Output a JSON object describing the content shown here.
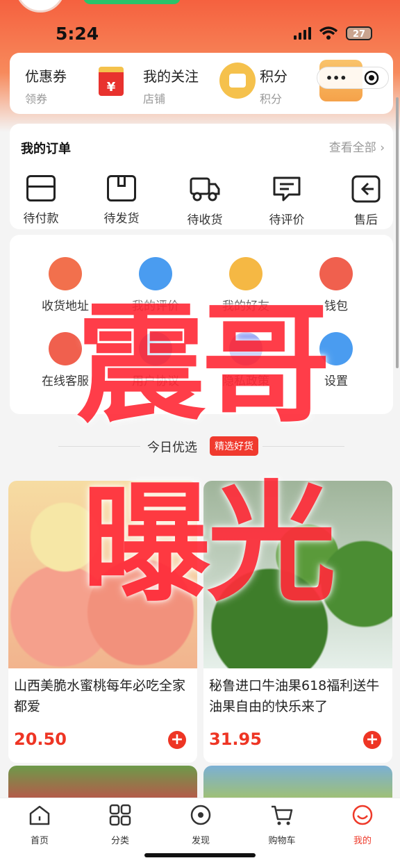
{
  "status_bar": {
    "time": "5:24",
    "battery": "27"
  },
  "top_card": {
    "coupon": {
      "title": "优惠券",
      "sub": "领券",
      "icon_text": "¥"
    },
    "follow": {
      "title": "我的关注",
      "sub": "店铺"
    },
    "points": {
      "title": "积分",
      "sub": "积分"
    },
    "mini_dots": "•••"
  },
  "orders": {
    "title": "我的订单",
    "view_all": "查看全部 ›",
    "items": [
      {
        "label": "待付款",
        "icon": "wallet-icon"
      },
      {
        "label": "待发货",
        "icon": "box-icon"
      },
      {
        "label": "待收货",
        "icon": "truck-icon"
      },
      {
        "label": "待评价",
        "icon": "comment-icon"
      },
      {
        "label": "售后",
        "icon": "return-icon"
      }
    ]
  },
  "services": [
    {
      "label": "收货地址",
      "icon": "location-icon",
      "color": "#f2704d"
    },
    {
      "label": "我的评价",
      "icon": "document-icon",
      "color": "#4a9cf0"
    },
    {
      "label": "我的好友",
      "icon": "crown-icon",
      "color": "#f5b844"
    },
    {
      "label": "钱包",
      "icon": "card-icon",
      "color": "#f0604e"
    },
    {
      "label": "在线客服",
      "icon": "headset-icon",
      "color": "#f0604e"
    },
    {
      "label": "用户协议",
      "icon": "agreement-icon",
      "color": "#4a9cf0"
    },
    {
      "label": "隐私政策",
      "icon": "privacy-icon",
      "color": "#7a8cf0"
    },
    {
      "label": "设置",
      "icon": "info-icon",
      "color": "#4a9cf0"
    }
  ],
  "watermark": {
    "line1": "震哥",
    "line2": "曝光"
  },
  "today": {
    "title": "今日优选",
    "tag": "精选好货"
  },
  "products": [
    {
      "title": "山西美脆水蜜桃每年必吃全家都爱",
      "price": "20.50"
    },
    {
      "title": "秘鲁进口牛油果618福利送牛油果自由的快乐来了",
      "price": "31.95"
    }
  ],
  "tabs": [
    {
      "label": "首页",
      "icon": "home-icon"
    },
    {
      "label": "分类",
      "icon": "category-icon"
    },
    {
      "label": "发现",
      "icon": "discover-icon"
    },
    {
      "label": "购物车",
      "icon": "cart-icon"
    },
    {
      "label": "我的",
      "icon": "profile-icon",
      "active": true
    }
  ],
  "colors": {
    "accent": "#ee3524",
    "header": "#f5613f"
  }
}
